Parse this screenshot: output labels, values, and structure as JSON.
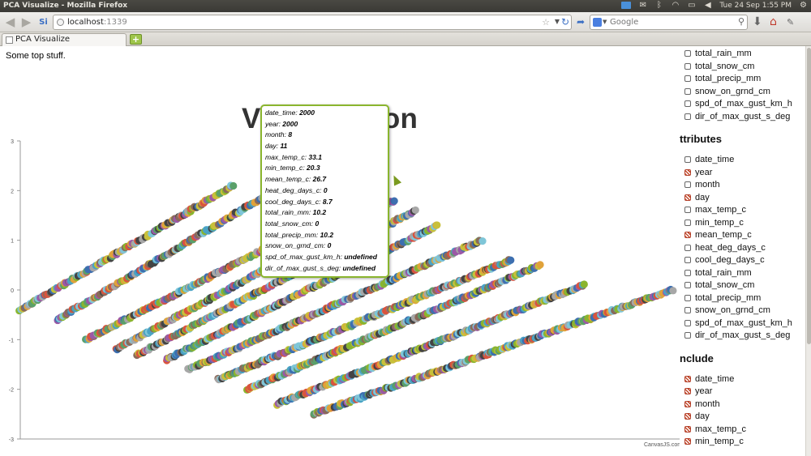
{
  "window": {
    "title": "PCA Visualize - Mozilla Firefox",
    "clock": "Tue 24 Sep  1:55 PM"
  },
  "nav": {
    "url_host": "localhost",
    "url_port": ":1339",
    "search_engine": "Google",
    "search_placeholder": "Google"
  },
  "tabs": [
    {
      "label": "PCA Visualize"
    }
  ],
  "page": {
    "top_text": "Some top stuff.",
    "title": "Visualization",
    "credit": "CanvasJS.com"
  },
  "tooltip": [
    {
      "key": "date_time",
      "value": "2000"
    },
    {
      "key": "year",
      "value": "2000"
    },
    {
      "key": "month",
      "value": "8"
    },
    {
      "key": "day",
      "value": "11"
    },
    {
      "key": "max_temp_c",
      "value": "33.1"
    },
    {
      "key": "min_temp_c",
      "value": "20.3"
    },
    {
      "key": "mean_temp_c",
      "value": "26.7"
    },
    {
      "key": "heat_deg_days_c",
      "value": "0"
    },
    {
      "key": "cool_deg_days_c",
      "value": "8.7"
    },
    {
      "key": "total_rain_mm",
      "value": "10.2"
    },
    {
      "key": "total_snow_cm",
      "value": "0"
    },
    {
      "key": "total_precip_mm",
      "value": "10.2"
    },
    {
      "key": "snow_on_grnd_cm",
      "value": "0"
    },
    {
      "key": "spd_of_max_gust_km_h",
      "value": "undefined"
    },
    {
      "key": "dir_of_max_gust_s_deg",
      "value": "undefined"
    }
  ],
  "sidebar": {
    "top_items": [
      {
        "label": "total_rain_mm",
        "checked": false
      },
      {
        "label": "total_snow_cm",
        "checked": false
      },
      {
        "label": "total_precip_mm",
        "checked": false
      },
      {
        "label": "snow_on_grnd_cm",
        "checked": false
      },
      {
        "label": "spd_of_max_gust_km_h",
        "checked": false
      },
      {
        "label": "dir_of_max_gust_s_deg",
        "checked": false
      }
    ],
    "attributes_heading": "ttributes",
    "attributes": [
      {
        "label": "date_time",
        "checked": false
      },
      {
        "label": "year",
        "checked": true
      },
      {
        "label": "month",
        "checked": false
      },
      {
        "label": "day",
        "checked": true
      },
      {
        "label": "max_temp_c",
        "checked": false
      },
      {
        "label": "min_temp_c",
        "checked": false
      },
      {
        "label": "mean_temp_c",
        "checked": true
      },
      {
        "label": "heat_deg_days_c",
        "checked": false
      },
      {
        "label": "cool_deg_days_c",
        "checked": false
      },
      {
        "label": "total_rain_mm",
        "checked": false
      },
      {
        "label": "total_snow_cm",
        "checked": false
      },
      {
        "label": "total_precip_mm",
        "checked": false
      },
      {
        "label": "snow_on_grnd_cm",
        "checked": false
      },
      {
        "label": "spd_of_max_gust_km_h",
        "checked": false
      },
      {
        "label": "dir_of_max_gust_s_deg",
        "checked": false
      }
    ],
    "include_heading": "nclude",
    "include": [
      {
        "label": "date_time",
        "checked": true
      },
      {
        "label": "year",
        "checked": true
      },
      {
        "label": "month",
        "checked": true
      },
      {
        "label": "day",
        "checked": true
      },
      {
        "label": "max_temp_c",
        "checked": true
      },
      {
        "label": "min_temp_c",
        "checked": true
      }
    ]
  },
  "chart_data": {
    "type": "scatter",
    "title": "Visualization",
    "ylim": [
      -3,
      3
    ],
    "y_ticks": [
      3,
      2,
      1,
      0,
      -1,
      -2,
      -3
    ],
    "xlim": [
      -4.5,
      4.5
    ],
    "marker_colors": [
      "#e0a23a",
      "#4aa3c4",
      "#9b59a6",
      "#8ab52e",
      "#3d6fb0",
      "#d9543e",
      "#7fc6d8",
      "#8a6a5a",
      "#444444",
      "#c8c03a",
      "#5aa06a",
      "#a7a7a7"
    ],
    "series": [
      {
        "x": [
          -4.5,
          -1.6
        ],
        "y": [
          -0.4,
          2.1
        ]
      },
      {
        "x": [
          -4.0,
          -0.8
        ],
        "y": [
          -0.6,
          2.2
        ]
      },
      {
        "x": [
          -3.6,
          0.4
        ],
        "y": [
          -1.0,
          2.0
        ]
      },
      {
        "x": [
          -3.2,
          0.6
        ],
        "y": [
          -1.2,
          1.8
        ]
      },
      {
        "x": [
          -2.9,
          0.9
        ],
        "y": [
          -1.3,
          1.6
        ]
      },
      {
        "x": [
          -2.5,
          1.2
        ],
        "y": [
          -1.4,
          1.3
        ]
      },
      {
        "x": [
          -2.2,
          1.8
        ],
        "y": [
          -1.6,
          1.0
        ]
      },
      {
        "x": [
          -1.8,
          2.2
        ],
        "y": [
          -1.8,
          0.6
        ]
      },
      {
        "x": [
          -1.4,
          2.6
        ],
        "y": [
          -2.0,
          0.5
        ]
      },
      {
        "x": [
          -1.0,
          3.2
        ],
        "y": [
          -2.3,
          0.1
        ]
      },
      {
        "x": [
          -0.5,
          4.4
        ],
        "y": [
          -2.5,
          0.0
        ]
      }
    ]
  }
}
